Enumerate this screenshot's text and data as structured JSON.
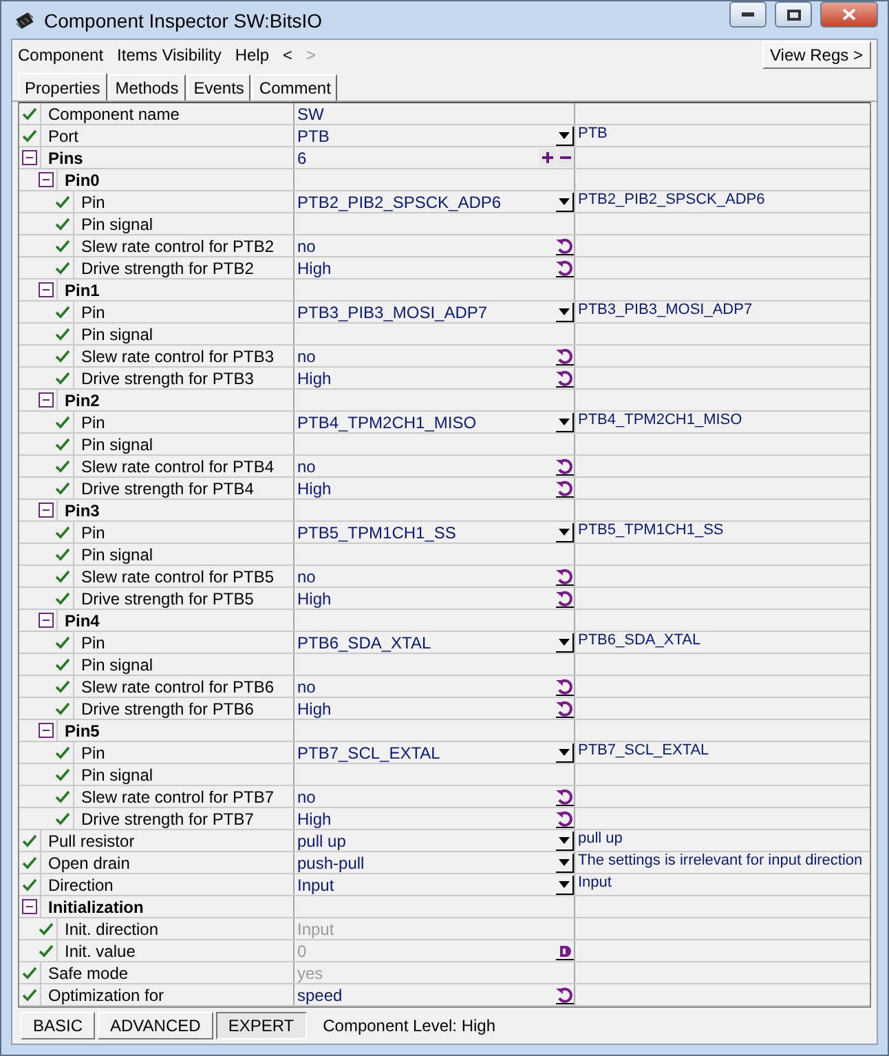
{
  "window": {
    "title": "Component Inspector SW:BitsIO"
  },
  "menu": [
    "Component",
    "Items Visibility",
    "Help",
    "<",
    ">"
  ],
  "view_regs_button": "View Regs >",
  "tabs": [
    {
      "label": "Properties",
      "selected": true
    },
    {
      "label": "Methods",
      "selected": false
    },
    {
      "label": "Events",
      "selected": false
    },
    {
      "label": "Comment",
      "selected": false
    }
  ],
  "properties": [
    {
      "kind": "text",
      "name": "Component name",
      "value": "SW",
      "checked": true
    },
    {
      "kind": "dropdown",
      "name": "Port",
      "value": "PTB",
      "info": "PTB",
      "checked": true
    },
    {
      "kind": "count",
      "name": "Pins",
      "value": "6",
      "expanded": true,
      "children": [
        {
          "kind": "group",
          "name": "Pin0",
          "expanded": true,
          "children": [
            {
              "kind": "dropdown",
              "name": "Pin",
              "value": "PTB2_PIB2_SPSCK_ADP6",
              "info": "PTB2_PIB2_SPSCK_ADP6",
              "checked": true
            },
            {
              "kind": "text",
              "name": "Pin signal",
              "checked": true
            },
            {
              "kind": "reset",
              "name": "Slew rate control for PTB2",
              "value": "no",
              "checked": true
            },
            {
              "kind": "reset",
              "name": "Drive strength for PTB2",
              "value": "High",
              "checked": true
            }
          ]
        },
        {
          "kind": "group",
          "name": "Pin1",
          "expanded": true,
          "children": [
            {
              "kind": "dropdown",
              "name": "Pin",
              "value": "PTB3_PIB3_MOSI_ADP7",
              "info": "PTB3_PIB3_MOSI_ADP7",
              "checked": true
            },
            {
              "kind": "text",
              "name": "Pin signal",
              "checked": true
            },
            {
              "kind": "reset",
              "name": "Slew rate control for PTB3",
              "value": "no",
              "checked": true
            },
            {
              "kind": "reset",
              "name": "Drive strength for PTB3",
              "value": "High",
              "checked": true
            }
          ]
        },
        {
          "kind": "group",
          "name": "Pin2",
          "expanded": true,
          "children": [
            {
              "kind": "dropdown",
              "name": "Pin",
              "value": "PTB4_TPM2CH1_MISO",
              "info": "PTB4_TPM2CH1_MISO",
              "checked": true
            },
            {
              "kind": "text",
              "name": "Pin signal",
              "checked": true
            },
            {
              "kind": "reset",
              "name": "Slew rate control for PTB4",
              "value": "no",
              "checked": true
            },
            {
              "kind": "reset",
              "name": "Drive strength for PTB4",
              "value": "High",
              "checked": true
            }
          ]
        },
        {
          "kind": "group",
          "name": "Pin3",
          "expanded": true,
          "children": [
            {
              "kind": "dropdown",
              "name": "Pin",
              "value": "PTB5_TPM1CH1_SS",
              "info": "PTB5_TPM1CH1_SS",
              "checked": true
            },
            {
              "kind": "text",
              "name": "Pin signal",
              "checked": true
            },
            {
              "kind": "reset",
              "name": "Slew rate control for PTB5",
              "value": "no",
              "checked": true
            },
            {
              "kind": "reset",
              "name": "Drive strength for PTB5",
              "value": "High",
              "checked": true
            }
          ]
        },
        {
          "kind": "group",
          "name": "Pin4",
          "expanded": true,
          "children": [
            {
              "kind": "dropdown",
              "name": "Pin",
              "value": "PTB6_SDA_XTAL",
              "info": "PTB6_SDA_XTAL",
              "checked": true
            },
            {
              "kind": "text",
              "name": "Pin signal",
              "checked": true
            },
            {
              "kind": "reset",
              "name": "Slew rate control for PTB6",
              "value": "no",
              "checked": true
            },
            {
              "kind": "reset",
              "name": "Drive strength for PTB6",
              "value": "High",
              "checked": true
            }
          ]
        },
        {
          "kind": "group",
          "name": "Pin5",
          "expanded": true,
          "children": [
            {
              "kind": "dropdown",
              "name": "Pin",
              "value": "PTB7_SCL_EXTAL",
              "info": "PTB7_SCL_EXTAL",
              "checked": true
            },
            {
              "kind": "text",
              "name": "Pin signal",
              "checked": true
            },
            {
              "kind": "reset",
              "name": "Slew rate control for PTB7",
              "value": "no",
              "checked": true
            },
            {
              "kind": "reset",
              "name": "Drive strength for PTB7",
              "value": "High",
              "checked": true
            }
          ]
        }
      ]
    },
    {
      "kind": "dropdown",
      "name": "Pull resistor",
      "value": "pull up",
      "info": "pull up",
      "checked": true
    },
    {
      "kind": "dropdown",
      "name": "Open drain",
      "value": "push-pull",
      "info": "The settings is irrelevant for input direction",
      "checked": true
    },
    {
      "kind": "dropdown",
      "name": "Direction",
      "value": "Input",
      "info": "Input",
      "checked": true
    },
    {
      "kind": "group",
      "name": "Initialization",
      "expanded": true,
      "children": [
        {
          "kind": "text",
          "name": "Init. direction",
          "value": "Input",
          "disabled": true,
          "checked": true
        },
        {
          "kind": "edit",
          "name": "Init. value",
          "value": "0",
          "disabled": true,
          "checked": true
        }
      ]
    },
    {
      "kind": "text",
      "name": "Safe mode",
      "value": "yes",
      "disabled": true,
      "checked": true
    },
    {
      "kind": "reset",
      "name": "Optimization for",
      "value": "speed",
      "checked": true
    }
  ],
  "levels": [
    {
      "label": "BASIC",
      "selected": false
    },
    {
      "label": "ADVANCED",
      "selected": false
    },
    {
      "label": "EXPERT",
      "selected": true
    }
  ],
  "status": "Component Level: High"
}
